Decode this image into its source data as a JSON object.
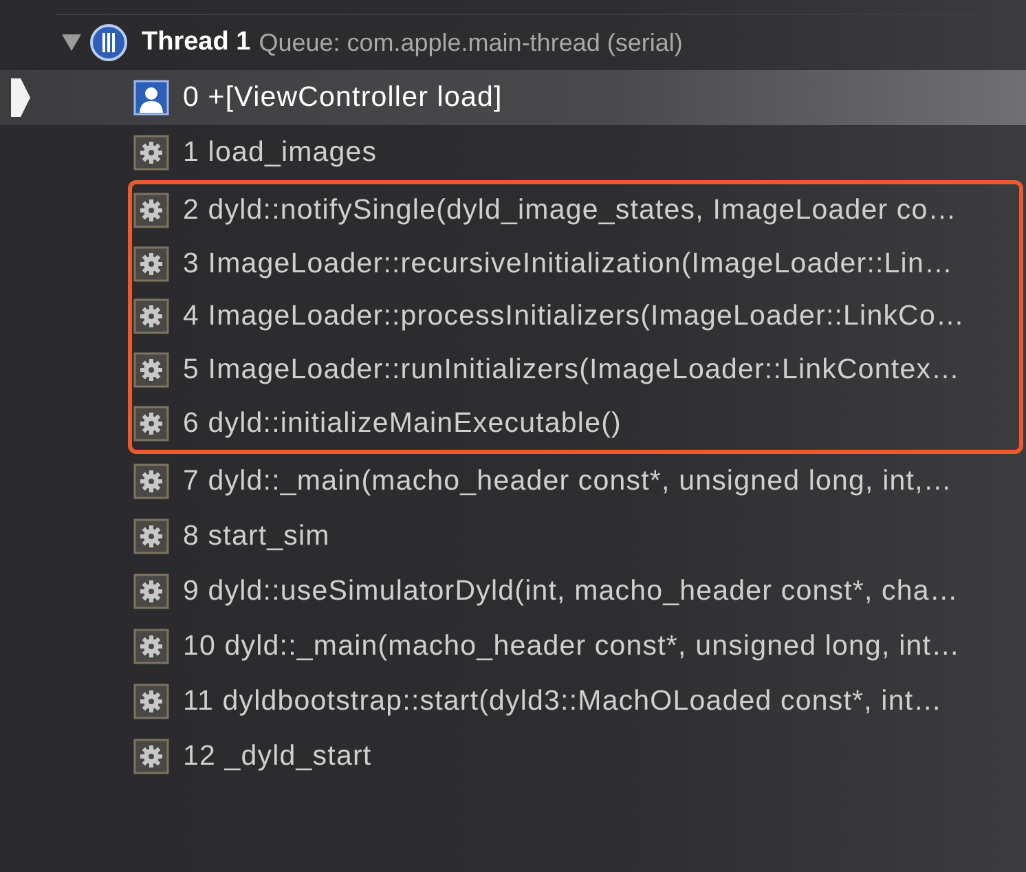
{
  "thread": {
    "expanded": true,
    "title": "Thread 1",
    "queue": "Queue: com.apple.main-thread (serial)"
  },
  "frames": [
    {
      "label": "0 +[ViewController load]",
      "kind": "user",
      "selected": true,
      "boxed": false
    },
    {
      "label": "1 load_images",
      "kind": "system",
      "selected": false,
      "boxed": false
    },
    {
      "label": "2 dyld::notifySingle(dyld_image_states, ImageLoader co…",
      "kind": "system",
      "selected": false,
      "boxed": true
    },
    {
      "label": "3 ImageLoader::recursiveInitialization(ImageLoader::Lin…",
      "kind": "system",
      "selected": false,
      "boxed": true
    },
    {
      "label": "4 ImageLoader::processInitializers(ImageLoader::LinkCo…",
      "kind": "system",
      "selected": false,
      "boxed": true
    },
    {
      "label": "5 ImageLoader::runInitializers(ImageLoader::LinkContex…",
      "kind": "system",
      "selected": false,
      "boxed": true
    },
    {
      "label": "6 dyld::initializeMainExecutable()",
      "kind": "system",
      "selected": false,
      "boxed": true
    },
    {
      "label": "7 dyld::_main(macho_header const*, unsigned long, int,…",
      "kind": "system",
      "selected": false,
      "boxed": false
    },
    {
      "label": "8 start_sim",
      "kind": "system",
      "selected": false,
      "boxed": false
    },
    {
      "label": "9 dyld::useSimulatorDyld(int, macho_header const*, cha…",
      "kind": "system",
      "selected": false,
      "boxed": false
    },
    {
      "label": "10 dyld::_main(macho_header const*, unsigned long, int…",
      "kind": "system",
      "selected": false,
      "boxed": false
    },
    {
      "label": "11 dyldbootstrap::start(dyld3::MachOLoaded const*, int…",
      "kind": "system",
      "selected": false,
      "boxed": false
    },
    {
      "label": "12 _dyld_start",
      "kind": "system",
      "selected": false,
      "boxed": false
    }
  ]
}
